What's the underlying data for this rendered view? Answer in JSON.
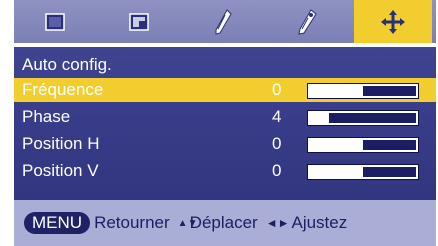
{
  "tabs": [
    {
      "icon": "screen-icon",
      "active": false
    },
    {
      "icon": "picture-in-picture-icon",
      "active": false
    },
    {
      "icon": "adjust-tool-icon",
      "active": false
    },
    {
      "icon": "settings-tool-icon",
      "active": false
    },
    {
      "icon": "position-arrows-icon",
      "active": true
    }
  ],
  "menu": {
    "title": "Auto config.",
    "items": [
      {
        "label": "Fréquence",
        "value": "0",
        "level": 0.5,
        "selected": true
      },
      {
        "label": "Phase",
        "value": "4",
        "level": 0.18,
        "selected": false
      },
      {
        "label": "Position H",
        "value": "0",
        "level": 0.5,
        "selected": false
      },
      {
        "label": "Position V",
        "value": "0",
        "level": 0.5,
        "selected": false
      }
    ]
  },
  "help": {
    "menu_key": "MENU",
    "back": "Retourner",
    "move_symbol": "▲▼",
    "move": "Déplacer",
    "adjust_symbol": "◄►",
    "adjust": "Ajustez"
  },
  "colors": {
    "accent": "#f2cd2e",
    "panel": "#363a86",
    "tabbar": "#8588bb",
    "helpbar": "#aaaed6"
  }
}
